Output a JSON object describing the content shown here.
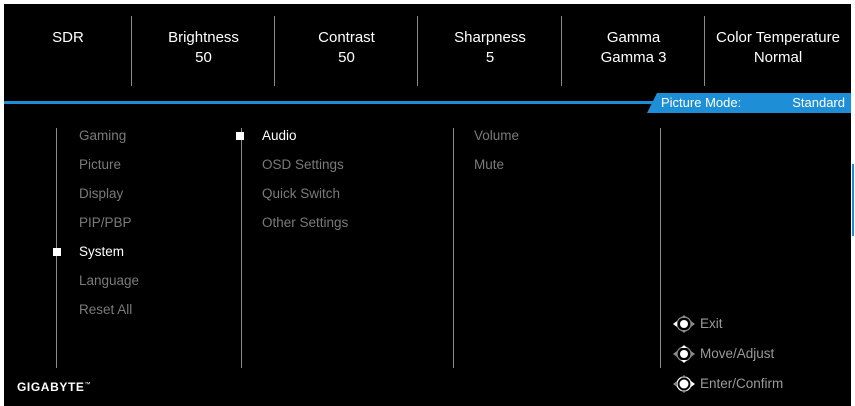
{
  "top_bar": {
    "items": [
      {
        "label": "SDR",
        "value": ""
      },
      {
        "label": "Brightness",
        "value": "50"
      },
      {
        "label": "Contrast",
        "value": "50"
      },
      {
        "label": "Sharpness",
        "value": "5"
      },
      {
        "label": "Gamma",
        "value": "Gamma 3"
      },
      {
        "label": "Color Temperature",
        "value": "Normal"
      }
    ]
  },
  "picture_mode": {
    "label": "Picture Mode:",
    "value": "Standard"
  },
  "menu": {
    "main": [
      "Gaming",
      "Picture",
      "Display",
      "PIP/PBP",
      "System",
      "Language",
      "Reset All"
    ],
    "main_selected": "System",
    "sub": [
      "Audio",
      "OSD Settings",
      "Quick Switch",
      "Other Settings"
    ],
    "sub_selected": "Audio",
    "options": [
      "Volume",
      "Mute"
    ]
  },
  "hints": [
    {
      "icon": "joystick-left-right-icon",
      "label": "Exit"
    },
    {
      "icon": "joystick-up-down-icon",
      "label": "Move/Adjust"
    },
    {
      "icon": "joystick-press-icon",
      "label": "Enter/Confirm"
    }
  ],
  "brand": {
    "name": "GIGABYTE",
    "mark": "™"
  },
  "colors": {
    "background": "#000000",
    "accent": "#1e8fd6",
    "text_active": "#ffffff",
    "text_inactive": "#7a7a7a"
  }
}
